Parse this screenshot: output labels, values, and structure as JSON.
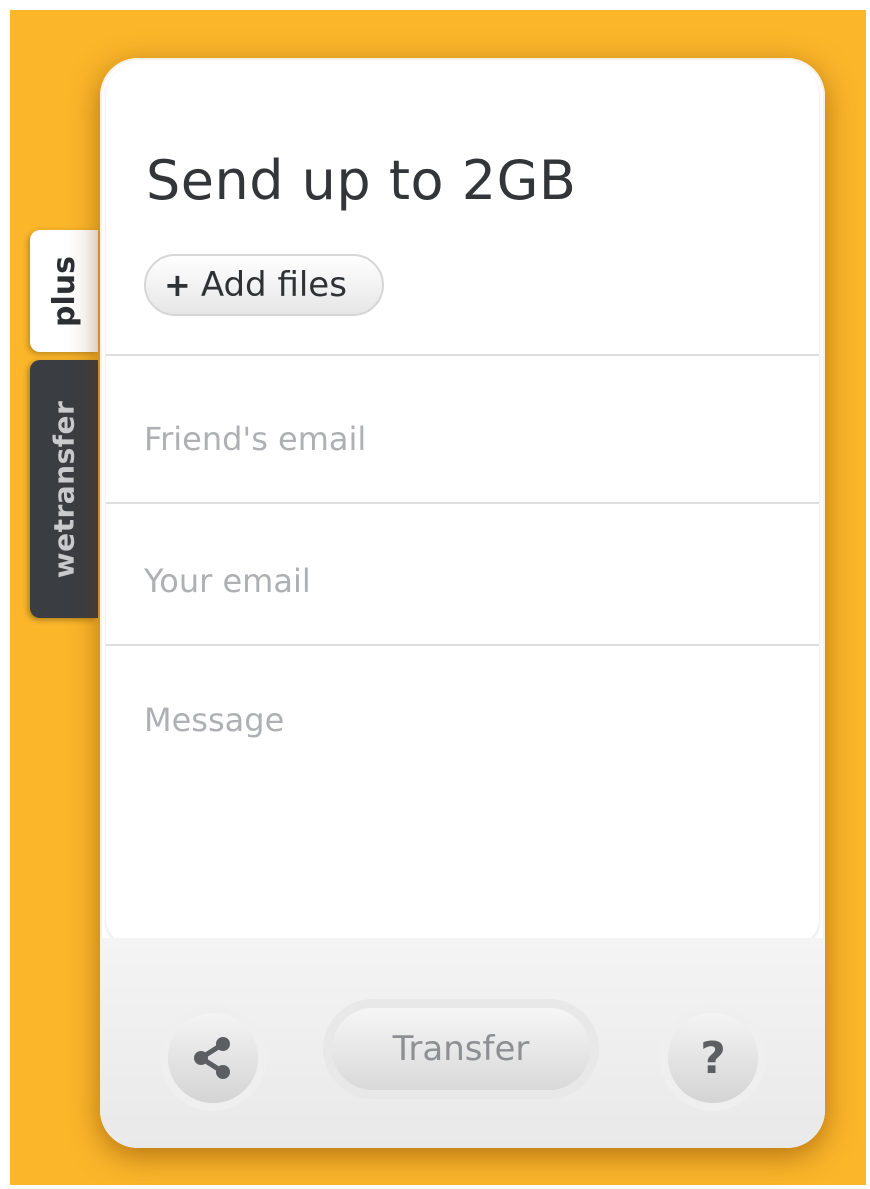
{
  "header": {
    "title": "Send up to 2GB"
  },
  "tabs": [
    {
      "label": "plus"
    },
    {
      "label": "wetransfer"
    }
  ],
  "add_files": {
    "plus_glyph": "+",
    "label": "Add files",
    "icon": "plus-icon"
  },
  "form": {
    "friend_email_placeholder": "Friend's email",
    "your_email_placeholder": "Your email",
    "message_placeholder": "Message"
  },
  "footer": {
    "transfer_label": "Transfer",
    "help_label": "?",
    "share_icon": "share-icon"
  },
  "colors": {
    "background": "#fbb62a",
    "tab_dark": "#3a3d42",
    "text": "#333538"
  }
}
